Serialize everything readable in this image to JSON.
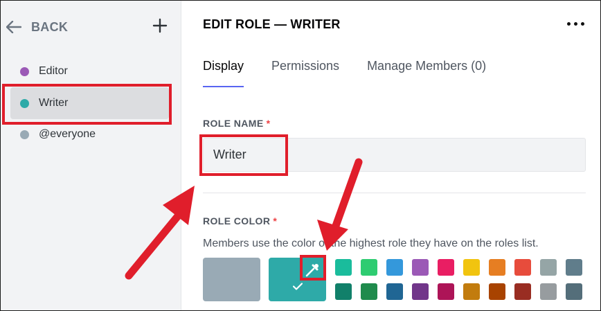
{
  "sidebar": {
    "back_label": "BACK",
    "roles": [
      {
        "name": "Editor",
        "color": "#9b59b6"
      },
      {
        "name": "Writer",
        "color": "#2eaaa8"
      },
      {
        "name": "@everyone",
        "color": "#99aab5"
      }
    ]
  },
  "header": {
    "title": "EDIT ROLE — WRITER"
  },
  "tabs": [
    {
      "label": "Display",
      "active": true
    },
    {
      "label": "Permissions",
      "active": false
    },
    {
      "label": "Manage Members (0)",
      "active": false
    }
  ],
  "role_name": {
    "label": "ROLE NAME",
    "required_mark": "*",
    "value": "Writer"
  },
  "role_color": {
    "label": "ROLE COLOR",
    "required_mark": "*",
    "description": "Members use the color of the highest role they have on the roles list.",
    "default_color": "#99aab5",
    "custom_color": "#2eaaa8",
    "palette_top": [
      "#1abc9c",
      "#2ecc71",
      "#3498db",
      "#9b59b6",
      "#e91e63",
      "#f1c40f",
      "#e67e22",
      "#e74c3c",
      "#95a5a6",
      "#607d8b"
    ],
    "palette_bottom": [
      "#11806a",
      "#1f8b4c",
      "#206694",
      "#71368a",
      "#ad1457",
      "#c27c0e",
      "#a84300",
      "#992d22",
      "#979c9f",
      "#546e7a"
    ]
  },
  "annotation_color": "#e01e2b"
}
